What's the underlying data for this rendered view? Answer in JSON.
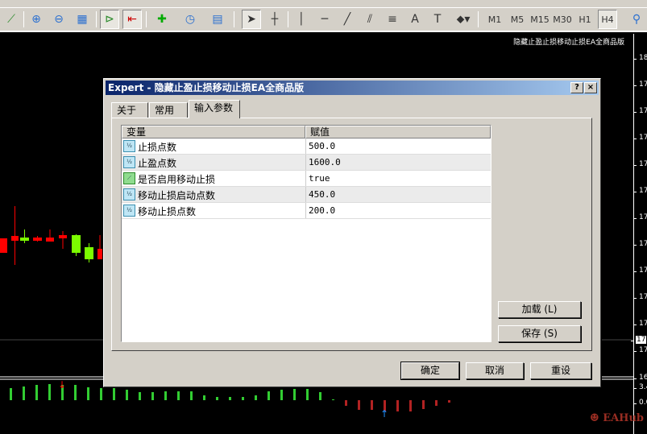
{
  "toolbar": {
    "icons": [
      "line-chart-icon",
      "zoom-in-icon",
      "zoom-out-icon",
      "tile-windows-icon",
      "auto-scroll-icon",
      "chart-shift-icon",
      "new-indicator-icon",
      "periods-icon",
      "templates-icon",
      "cursor-icon",
      "crosshair-icon",
      "vertical-line-icon",
      "horizontal-line-icon",
      "trendline-icon",
      "equidistant-channel-icon",
      "fibonacci-icon",
      "text-icon",
      "text-label-icon",
      "arrows-icon",
      "search-icon"
    ],
    "timeframes": [
      "M1",
      "M5",
      "M15",
      "M30",
      "H1",
      "H4"
    ],
    "active_timeframe": "H4"
  },
  "chart": {
    "ea_label": "隐藏止盈止损移动止损EA全商品版",
    "axis_labels": [
      "18",
      "17",
      "17",
      "17",
      "17",
      "17",
      "17",
      "17",
      "17",
      "17",
      "17",
      "17",
      "17",
      "16",
      "3.4",
      "0.0"
    ],
    "current_price_label": "17",
    "watermark": "EAHub",
    "histogram": [
      15,
      17,
      19,
      20,
      19,
      19,
      16,
      15,
      15,
      13,
      10,
      10,
      11,
      11,
      11,
      6,
      4,
      4,
      4,
      6,
      11,
      13,
      14,
      14,
      10,
      0,
      -7,
      -12,
      -12,
      -14,
      -14,
      -14,
      -11,
      -7,
      -3
    ],
    "colors": {
      "bull": "#7cfc00",
      "bear": "#ff0000",
      "hist_pos": "#32cd32",
      "hist_neg": "#b22222"
    }
  },
  "dialog": {
    "title": "Expert - 隐藏止盈止损移动止损EA全商品版",
    "help": "?",
    "close": "×",
    "tabs": [
      {
        "label": "关于"
      },
      {
        "label": "常用"
      },
      {
        "label": "输入参数",
        "active": true
      }
    ],
    "columns": [
      "变量",
      "赋值"
    ],
    "params": [
      {
        "name": "止损点数",
        "value": "500.0",
        "type": "double"
      },
      {
        "name": "止盈点数",
        "value": "1600.0",
        "type": "double"
      },
      {
        "name": "是否启用移动止损",
        "value": "true",
        "type": "bool"
      },
      {
        "name": "移动止损启动点数",
        "value": "450.0",
        "type": "double"
      },
      {
        "name": "移动止损点数",
        "value": "200.0",
        "type": "double"
      }
    ],
    "load": "加载 (L)",
    "save": "保存 (S)",
    "ok": "确定",
    "cancel": "取消",
    "reset": "重设"
  }
}
